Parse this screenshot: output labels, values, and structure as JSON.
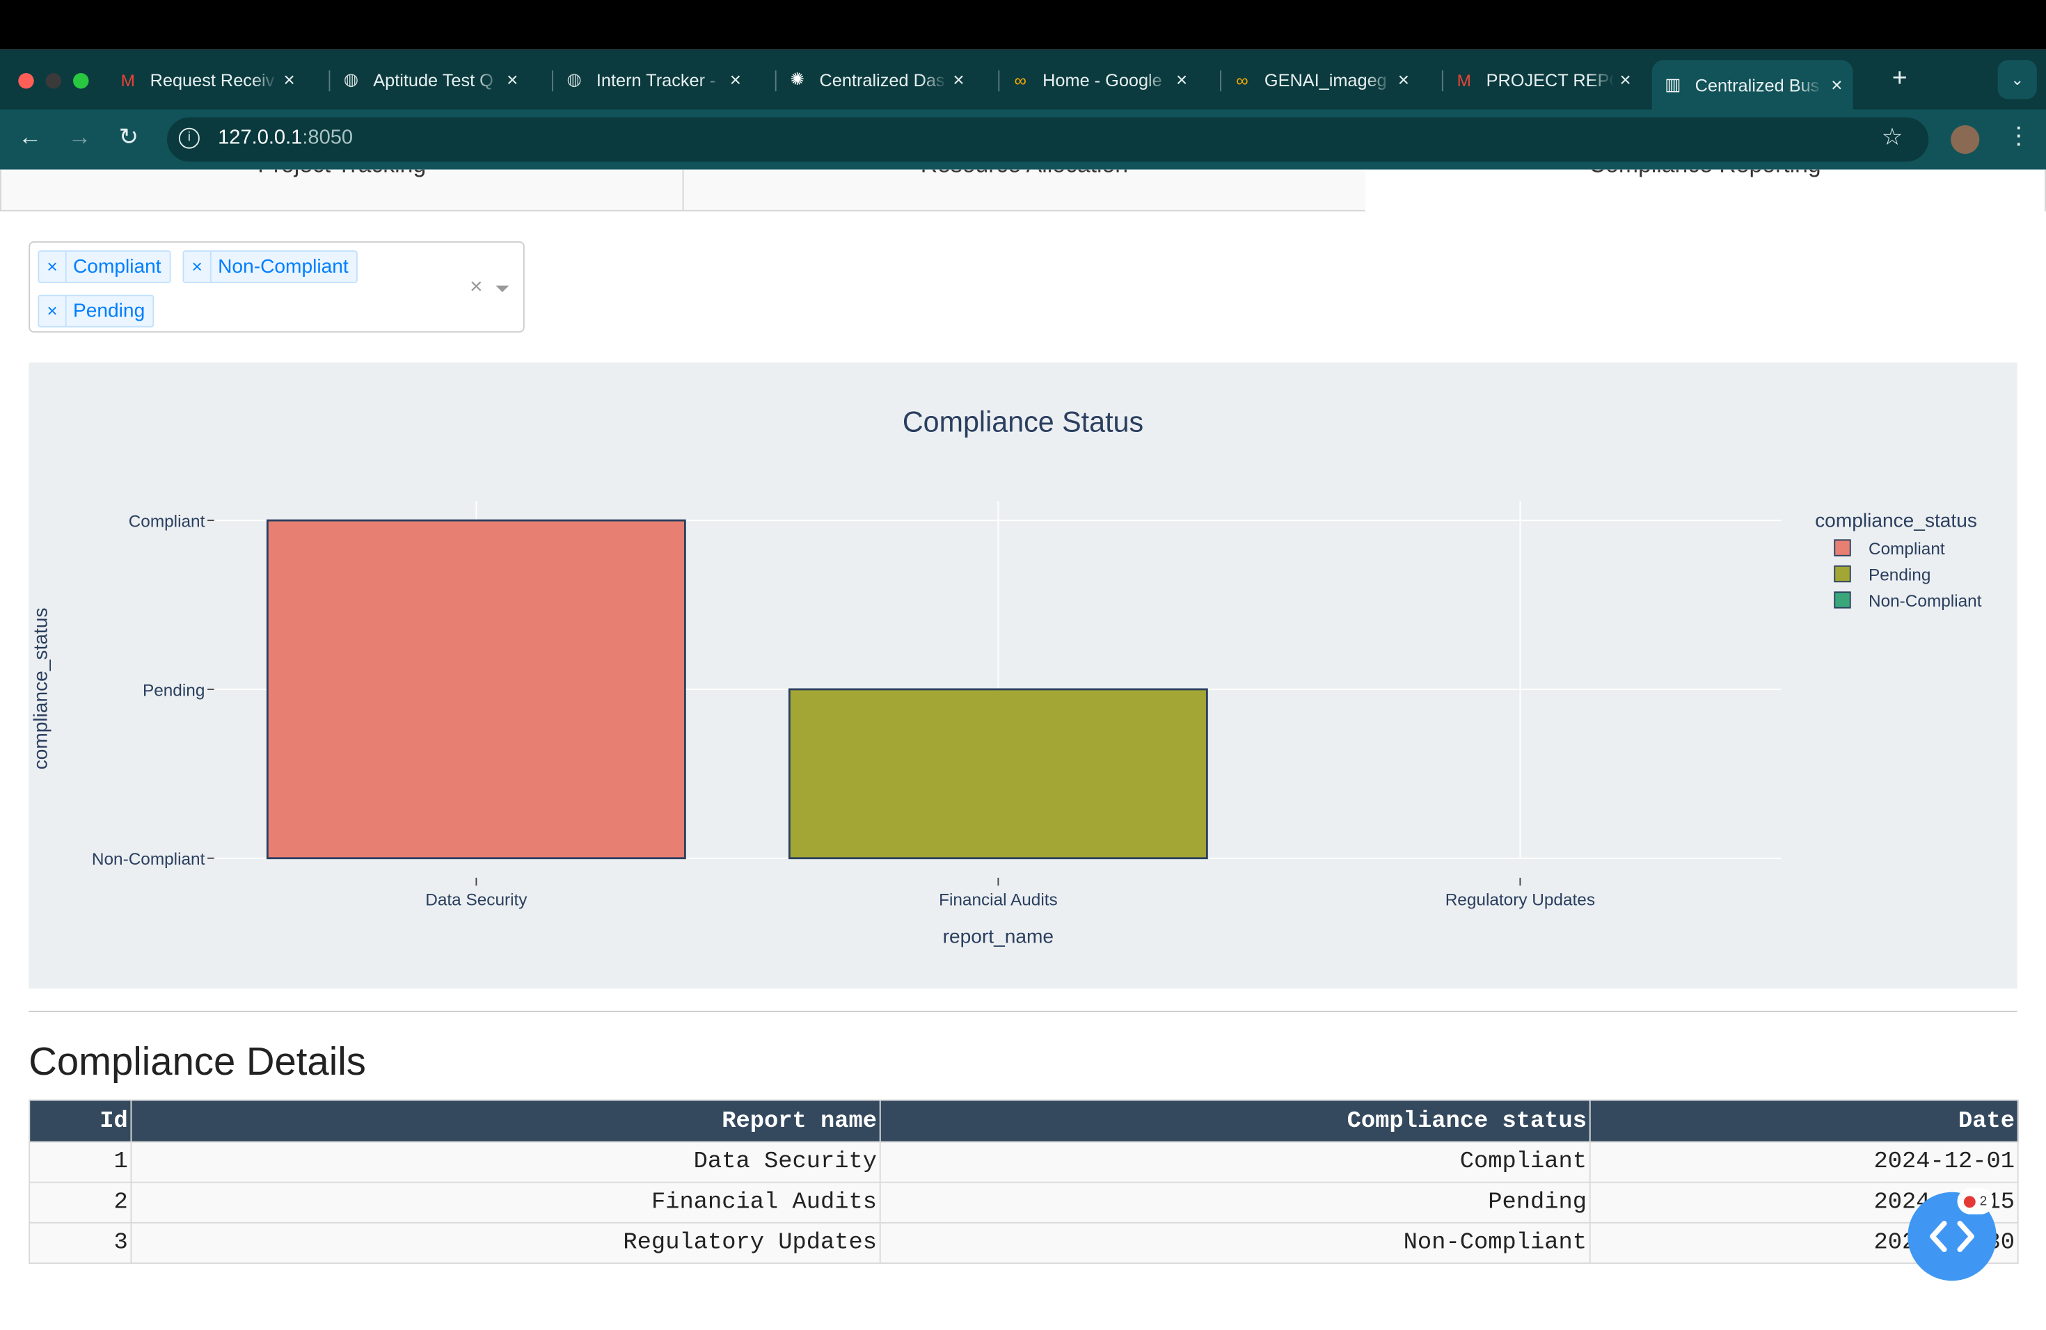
{
  "browser": {
    "tabs": [
      {
        "label": "Request Receiv",
        "icon": "gmail-icon"
      },
      {
        "label": "Aptitude Test Q",
        "icon": "globe-icon"
      },
      {
        "label": "Intern Tracker -",
        "icon": "globe-icon"
      },
      {
        "label": "Centralized Das",
        "icon": "openai-icon"
      },
      {
        "label": "Home - Google",
        "icon": "colab-icon"
      },
      {
        "label": "GENAI_imageg",
        "icon": "colab-icon"
      },
      {
        "label": "PROJECT REPO",
        "icon": "gmail-icon"
      },
      {
        "label": "Centralized Bus",
        "icon": "dash-icon",
        "active": true
      }
    ],
    "url_host": "127.0.0.1",
    "url_port": ":8050"
  },
  "page_tabs": [
    "Project Tracking",
    "Resource Allocation",
    "Compliance Reporting"
  ],
  "filter": {
    "selected": [
      "Compliant",
      "Non-Compliant",
      "Pending"
    ],
    "clear_symbol": "×"
  },
  "chart_data": {
    "type": "bar",
    "title": "Compliance Status",
    "xlabel": "report_name",
    "ylabel": "compliance_status",
    "categories": [
      "Data Security",
      "Financial Audits",
      "Regulatory Updates"
    ],
    "y_categories": [
      "Non-Compliant",
      "Pending",
      "Compliant"
    ],
    "values": [
      "Compliant",
      "Pending",
      "Non-Compliant"
    ],
    "legend_title": "compliance_status",
    "legend": [
      "Compliant",
      "Pending",
      "Non-Compliant"
    ],
    "colors": {
      "Compliant": "#e87f73",
      "Pending": "#a3a635",
      "Non-Compliant": "#3aa77b"
    },
    "grid": true,
    "legend_position": "right"
  },
  "details": {
    "title": "Compliance Details",
    "columns": [
      "Id",
      "Report name",
      "Compliance status",
      "Date"
    ],
    "rows": [
      [
        "1",
        "Data Security",
        "Compliant",
        "2024-12-01"
      ],
      [
        "2",
        "Financial Audits",
        "Pending",
        "2024-11-15"
      ],
      [
        "3",
        "Regulatory Updates",
        "Non-Compliant",
        "2024-10-30"
      ]
    ]
  },
  "debug_badge": "2"
}
